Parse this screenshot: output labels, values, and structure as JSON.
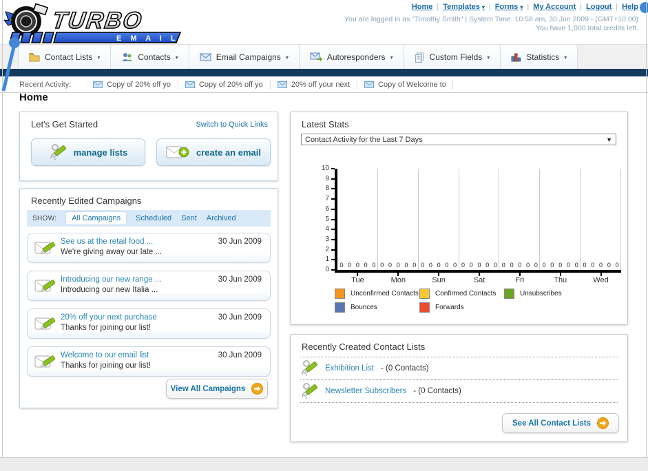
{
  "header": {
    "logo": {
      "title": "TURBO",
      "subtitle": "E M A I L"
    },
    "nav_links": [
      {
        "label": "Home",
        "has_dropdown": false
      },
      {
        "label": "Templates",
        "has_dropdown": true
      },
      {
        "label": "Forms",
        "has_dropdown": true
      },
      {
        "label": "My Account",
        "has_dropdown": false
      },
      {
        "label": "Logout",
        "has_dropdown": false
      },
      {
        "label": "Help",
        "has_dropdown": false
      }
    ],
    "login_line": "You are logged in as \"Timothy Smith\" | System Time: 10:58 am, 30 Jun 2009 - (GMT+10:00)",
    "credits_line": "You have 1,000 total credits left."
  },
  "nav_tabs": [
    {
      "label": "Contact Lists",
      "icon": "folder-icon"
    },
    {
      "label": "Contacts",
      "icon": "contacts-icon"
    },
    {
      "label": "Email Campaigns",
      "icon": "envelope-icon"
    },
    {
      "label": "Autoresponders",
      "icon": "autoresponder-icon"
    },
    {
      "label": "Custom Fields",
      "icon": "custom-fields-icon"
    },
    {
      "label": "Statistics",
      "icon": "statistics-icon"
    }
  ],
  "recent_activity": {
    "label": "Recent Activity:",
    "items": [
      "Copy of 20% off yo",
      "Copy of 20% off yo",
      "20% off your next",
      "Copy of Welcome to"
    ]
  },
  "page_title": "Home",
  "get_started": {
    "title": "Let's Get Started",
    "switch_link": "Switch to Quick Links",
    "buttons": [
      {
        "label": "manage lists",
        "icon": "person-pencil-icon"
      },
      {
        "label": "create an email",
        "icon": "envelope-plus-icon"
      }
    ]
  },
  "campaigns": {
    "title": "Recently Edited Campaigns",
    "show_label": "SHOW:",
    "tabs": [
      {
        "label": "All Campaigns",
        "active": true
      },
      {
        "label": "Scheduled",
        "active": false
      },
      {
        "label": "Sent",
        "active": false
      },
      {
        "label": "Archived",
        "active": false
      }
    ],
    "items": [
      {
        "title": "See us at the retail food ...",
        "subtitle": "We're giving away our late ...",
        "date": "30 Jun 2009"
      },
      {
        "title": "Introducing our new range ...",
        "subtitle": "Introducing our new Italia ...",
        "date": "30 Jun 2009"
      },
      {
        "title": "20% off your next purchase",
        "subtitle": "Thanks for joining our list!",
        "date": "30 Jun 2009"
      },
      {
        "title": "Welcome to our email list",
        "subtitle": "Thanks for joining our list!",
        "date": "30 Jun 2009"
      }
    ],
    "view_all_label": "View All Campaigns"
  },
  "latest_stats": {
    "title": "Latest Stats",
    "selected_option": "Contact Activity for the Last 7 Days"
  },
  "chart_data": {
    "type": "bar",
    "title": "Contact Activity for the Last 7 Days",
    "categories": [
      "Tue",
      "Mon",
      "Sun",
      "Sat",
      "Fri",
      "Thu",
      "Wed"
    ],
    "series": [
      {
        "name": "Unconfirmed Contacts",
        "color": "#f7941d",
        "values": [
          0,
          0,
          0,
          0,
          0,
          0,
          0
        ]
      },
      {
        "name": "Confirmed Contacts",
        "color": "#fdc72f",
        "values": [
          0,
          0,
          0,
          0,
          0,
          0,
          0
        ]
      },
      {
        "name": "Unsubscribes",
        "color": "#6ca522",
        "values": [
          0,
          0,
          0,
          0,
          0,
          0,
          0
        ]
      },
      {
        "name": "Bounces",
        "color": "#5b76b0",
        "values": [
          0,
          0,
          0,
          0,
          0,
          0,
          0
        ]
      },
      {
        "name": "Forwards",
        "color": "#ee4a2b",
        "values": [
          0,
          0,
          0,
          0,
          0,
          0,
          0
        ]
      }
    ],
    "ylim": [
      0,
      10
    ],
    "yticks": [
      0,
      1,
      2,
      3,
      4,
      5,
      6,
      7,
      8,
      9,
      10
    ],
    "bar_value_label": "0",
    "grid": "vertical",
    "legend_position": "bottom"
  },
  "contact_lists": {
    "title": "Recently Created Contact Lists",
    "items": [
      {
        "name": "Exhibition List",
        "suffix": " - (0 Contacts)"
      },
      {
        "name": "Newsletter Subscribers",
        "suffix": " - (0 Contacts)"
      }
    ],
    "see_all_label": "See All Contact Lists"
  },
  "colors": {
    "navy_bar": "#143a5e",
    "link_teal": "#1a76a8",
    "accent_blue": "#3f86d4",
    "arrow_orange": "#f2a718"
  }
}
